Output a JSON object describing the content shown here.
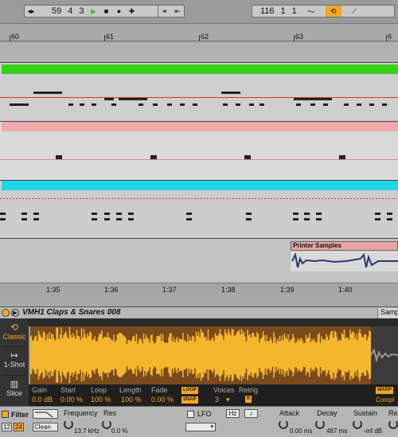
{
  "transport": {
    "position": [
      "59",
      "4",
      "3"
    ],
    "loop_length": [
      "116",
      "1",
      "1"
    ],
    "icons": [
      "cycle-icon",
      "play-icon",
      "stop-icon",
      "record-icon",
      "add-icon",
      "link-icon",
      "arrow-icon",
      "curve-icon",
      "loop-icon",
      "ramp-icon"
    ]
  },
  "ruler": {
    "bars": [
      "60",
      "61",
      "62",
      "63"
    ]
  },
  "bottom_ruler": {
    "times": [
      "1:35",
      "1:36",
      "1:37",
      "1:38",
      "1:39",
      "1:40"
    ]
  },
  "clips": {
    "printer": "Printer Samples"
  },
  "colors": {
    "green": "#37d11a",
    "pink": "#f0a9ad",
    "cyan": "#20d6e6",
    "salmon": "#e8a3a3",
    "waveform": "#f4b62c",
    "orange": "#f5a623"
  },
  "device": {
    "title": "VMH1 Claps & Snares 008",
    "tab_right": "Samp",
    "modes": [
      "Classic",
      "1-Shot",
      "Slice"
    ],
    "params": {
      "gain_label": "Gain",
      "gain_value": "0.0 dB",
      "start_label": "Start",
      "start_value": "0.00 %",
      "loop_label": "Loop",
      "loop_value": "100 %",
      "length_label": "Length",
      "length_value": "100 %",
      "fade_label": "Fade",
      "fade_value": "0.00 %",
      "loop_btn": "LOOP",
      "snap_btn": "SNAP",
      "voices_label": "Voices",
      "voices_value": "3",
      "retrig_label": "Retrig",
      "retrig_value": "R",
      "warp_btn": "WARP",
      "complex_label": "Compl"
    }
  },
  "bottom": {
    "filter_label": "Filter",
    "filter_values": [
      "12",
      "24"
    ],
    "filter_type": "Clean",
    "frequency_label": "Frequency",
    "frequency_value": "13.7 kHz",
    "res_label": "Res",
    "res_value": "0.0 %",
    "lfo_label": "LFO",
    "hz_label": "Hz",
    "attack_label": "Attack",
    "attack_value": "0.00 ms",
    "decay_label": "Decay",
    "decay_value": "487 ms",
    "sustain_label": "Sustain",
    "sustain_value": "-inf dB",
    "release_label": "Re"
  }
}
